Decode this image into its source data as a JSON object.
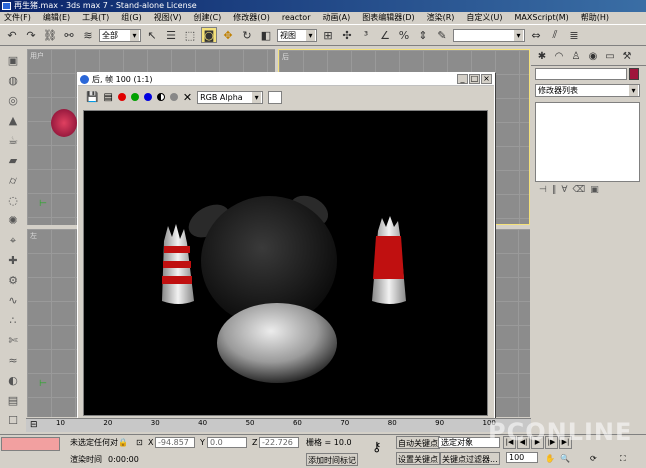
{
  "window": {
    "title": "再生猪.max - 3ds max 7 - Stand-alone License"
  },
  "menu": [
    "文件(F)",
    "编辑(E)",
    "工具(T)",
    "组(G)",
    "视图(V)",
    "创建(C)",
    "修改器(O)",
    "reactor",
    "动画(A)",
    "图表编辑器(D)",
    "渲染(R)",
    "自定义(U)",
    "MAXScript(M)",
    "帮助(H)"
  ],
  "toolbar": {
    "selection_filter": "全部",
    "coord_system": "视图"
  },
  "viewports": {
    "top_left": "用户",
    "top_right": "后",
    "bottom_left": "左"
  },
  "render_window": {
    "title": "后, 帧 100 (1:1)",
    "channel": "RGB Alpha"
  },
  "command_panel": {
    "modifier_list": "修改器列表"
  },
  "timeline": {
    "ticks": [
      "10",
      "20",
      "30",
      "40",
      "50",
      "60",
      "70",
      "80",
      "90",
      "100"
    ]
  },
  "status": {
    "selection": "未选定任何对象",
    "x_label": "X",
    "x_value": "-94.857",
    "y_label": "Y",
    "y_value": "0.0",
    "z_label": "Z",
    "z_value": "-22.726",
    "grid": "栅格 = 10.0",
    "auto_key": "自动关键点",
    "selected_dropdown": "选定对象",
    "set_key": "设置关键点",
    "key_filters": "关键点过滤器...",
    "render_time": "渲染时间",
    "render_time_value": "0:00:00",
    "add_tag": "添加时间标记",
    "frame": "100"
  },
  "watermark": "PCONLINE",
  "colors": {
    "accent_red": "#a0143c",
    "title_blue": "#0a246a"
  }
}
